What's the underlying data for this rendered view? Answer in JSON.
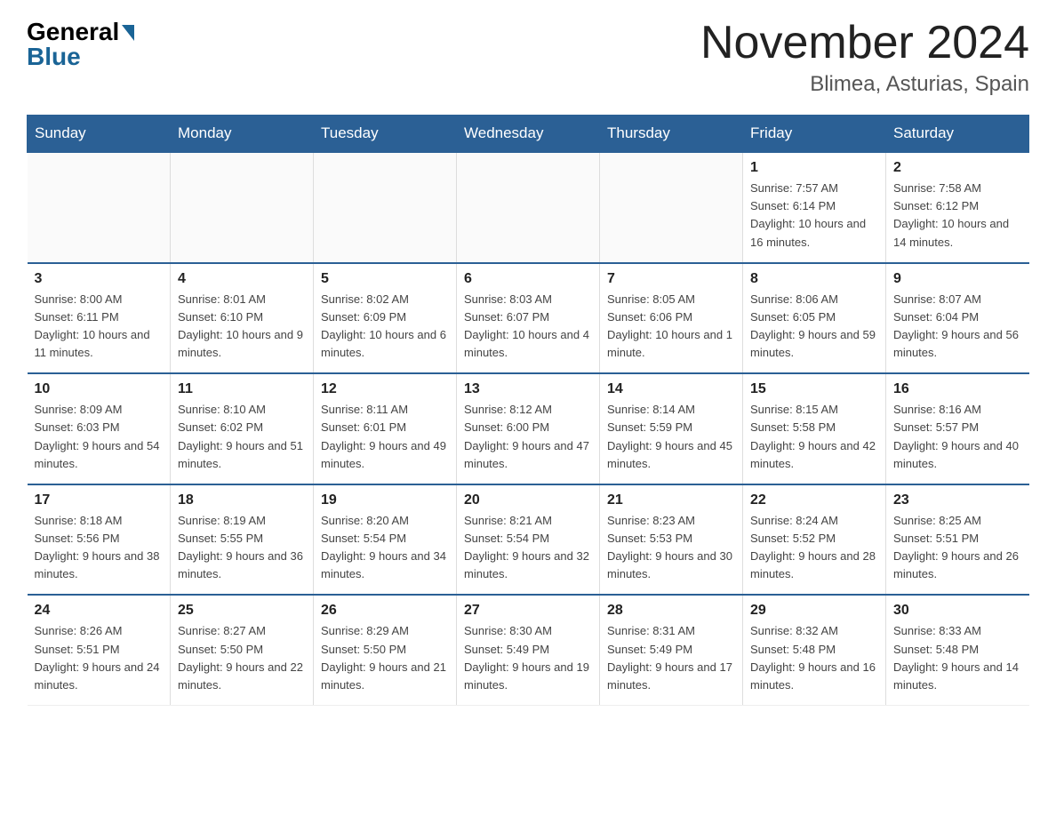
{
  "logo": {
    "general": "General",
    "blue": "Blue"
  },
  "header": {
    "month_year": "November 2024",
    "location": "Blimea, Asturias, Spain"
  },
  "days_of_week": [
    "Sunday",
    "Monday",
    "Tuesday",
    "Wednesday",
    "Thursday",
    "Friday",
    "Saturday"
  ],
  "weeks": [
    [
      {
        "day": "",
        "info": ""
      },
      {
        "day": "",
        "info": ""
      },
      {
        "day": "",
        "info": ""
      },
      {
        "day": "",
        "info": ""
      },
      {
        "day": "",
        "info": ""
      },
      {
        "day": "1",
        "info": "Sunrise: 7:57 AM\nSunset: 6:14 PM\nDaylight: 10 hours and 16 minutes."
      },
      {
        "day": "2",
        "info": "Sunrise: 7:58 AM\nSunset: 6:12 PM\nDaylight: 10 hours and 14 minutes."
      }
    ],
    [
      {
        "day": "3",
        "info": "Sunrise: 8:00 AM\nSunset: 6:11 PM\nDaylight: 10 hours and 11 minutes."
      },
      {
        "day": "4",
        "info": "Sunrise: 8:01 AM\nSunset: 6:10 PM\nDaylight: 10 hours and 9 minutes."
      },
      {
        "day": "5",
        "info": "Sunrise: 8:02 AM\nSunset: 6:09 PM\nDaylight: 10 hours and 6 minutes."
      },
      {
        "day": "6",
        "info": "Sunrise: 8:03 AM\nSunset: 6:07 PM\nDaylight: 10 hours and 4 minutes."
      },
      {
        "day": "7",
        "info": "Sunrise: 8:05 AM\nSunset: 6:06 PM\nDaylight: 10 hours and 1 minute."
      },
      {
        "day": "8",
        "info": "Sunrise: 8:06 AM\nSunset: 6:05 PM\nDaylight: 9 hours and 59 minutes."
      },
      {
        "day": "9",
        "info": "Sunrise: 8:07 AM\nSunset: 6:04 PM\nDaylight: 9 hours and 56 minutes."
      }
    ],
    [
      {
        "day": "10",
        "info": "Sunrise: 8:09 AM\nSunset: 6:03 PM\nDaylight: 9 hours and 54 minutes."
      },
      {
        "day": "11",
        "info": "Sunrise: 8:10 AM\nSunset: 6:02 PM\nDaylight: 9 hours and 51 minutes."
      },
      {
        "day": "12",
        "info": "Sunrise: 8:11 AM\nSunset: 6:01 PM\nDaylight: 9 hours and 49 minutes."
      },
      {
        "day": "13",
        "info": "Sunrise: 8:12 AM\nSunset: 6:00 PM\nDaylight: 9 hours and 47 minutes."
      },
      {
        "day": "14",
        "info": "Sunrise: 8:14 AM\nSunset: 5:59 PM\nDaylight: 9 hours and 45 minutes."
      },
      {
        "day": "15",
        "info": "Sunrise: 8:15 AM\nSunset: 5:58 PM\nDaylight: 9 hours and 42 minutes."
      },
      {
        "day": "16",
        "info": "Sunrise: 8:16 AM\nSunset: 5:57 PM\nDaylight: 9 hours and 40 minutes."
      }
    ],
    [
      {
        "day": "17",
        "info": "Sunrise: 8:18 AM\nSunset: 5:56 PM\nDaylight: 9 hours and 38 minutes."
      },
      {
        "day": "18",
        "info": "Sunrise: 8:19 AM\nSunset: 5:55 PM\nDaylight: 9 hours and 36 minutes."
      },
      {
        "day": "19",
        "info": "Sunrise: 8:20 AM\nSunset: 5:54 PM\nDaylight: 9 hours and 34 minutes."
      },
      {
        "day": "20",
        "info": "Sunrise: 8:21 AM\nSunset: 5:54 PM\nDaylight: 9 hours and 32 minutes."
      },
      {
        "day": "21",
        "info": "Sunrise: 8:23 AM\nSunset: 5:53 PM\nDaylight: 9 hours and 30 minutes."
      },
      {
        "day": "22",
        "info": "Sunrise: 8:24 AM\nSunset: 5:52 PM\nDaylight: 9 hours and 28 minutes."
      },
      {
        "day": "23",
        "info": "Sunrise: 8:25 AM\nSunset: 5:51 PM\nDaylight: 9 hours and 26 minutes."
      }
    ],
    [
      {
        "day": "24",
        "info": "Sunrise: 8:26 AM\nSunset: 5:51 PM\nDaylight: 9 hours and 24 minutes."
      },
      {
        "day": "25",
        "info": "Sunrise: 8:27 AM\nSunset: 5:50 PM\nDaylight: 9 hours and 22 minutes."
      },
      {
        "day": "26",
        "info": "Sunrise: 8:29 AM\nSunset: 5:50 PM\nDaylight: 9 hours and 21 minutes."
      },
      {
        "day": "27",
        "info": "Sunrise: 8:30 AM\nSunset: 5:49 PM\nDaylight: 9 hours and 19 minutes."
      },
      {
        "day": "28",
        "info": "Sunrise: 8:31 AM\nSunset: 5:49 PM\nDaylight: 9 hours and 17 minutes."
      },
      {
        "day": "29",
        "info": "Sunrise: 8:32 AM\nSunset: 5:48 PM\nDaylight: 9 hours and 16 minutes."
      },
      {
        "day": "30",
        "info": "Sunrise: 8:33 AM\nSunset: 5:48 PM\nDaylight: 9 hours and 14 minutes."
      }
    ]
  ]
}
